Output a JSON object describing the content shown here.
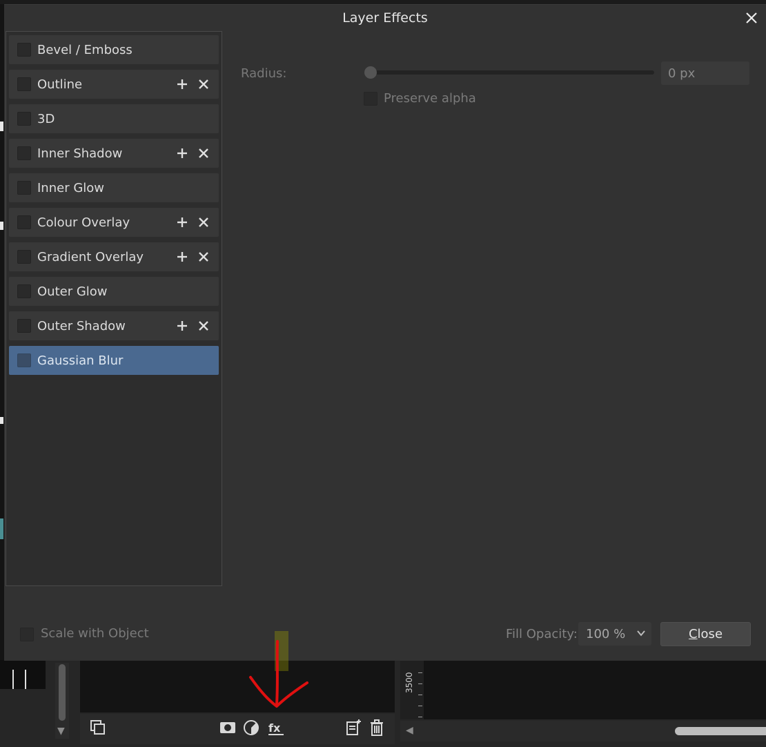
{
  "dialog": {
    "title": "Layer Effects",
    "effects": [
      {
        "label": "Bevel / Emboss",
        "addable": false,
        "checked": false
      },
      {
        "label": "Outline",
        "addable": true,
        "checked": false
      },
      {
        "label": "3D",
        "addable": false,
        "checked": false
      },
      {
        "label": "Inner Shadow",
        "addable": true,
        "checked": false
      },
      {
        "label": "Inner Glow",
        "addable": false,
        "checked": false
      },
      {
        "label": "Colour Overlay",
        "addable": true,
        "checked": false
      },
      {
        "label": "Gradient Overlay",
        "addable": true,
        "checked": false
      },
      {
        "label": "Outer Glow",
        "addable": false,
        "checked": false
      },
      {
        "label": "Outer Shadow",
        "addable": true,
        "checked": false
      },
      {
        "label": "Gaussian Blur",
        "addable": false,
        "checked": false,
        "selected": true
      }
    ],
    "properties": {
      "radius_label": "Radius:",
      "radius_value": "0 px",
      "radius_slider_fraction": 0,
      "preserve_alpha_label": "Preserve alpha"
    },
    "footer": {
      "scale_with_object_label": "Scale with Object",
      "fill_opacity_label": "Fill Opacity:",
      "fill_opacity_value": "100 %",
      "close_label_accel": "C",
      "close_label_rest": "lose"
    }
  },
  "background": {
    "ruler_label": "3500"
  },
  "colors": {
    "dialog_bg": "#323232",
    "selected_item": "#4a6990",
    "annotation_arrow": "#e01010"
  }
}
